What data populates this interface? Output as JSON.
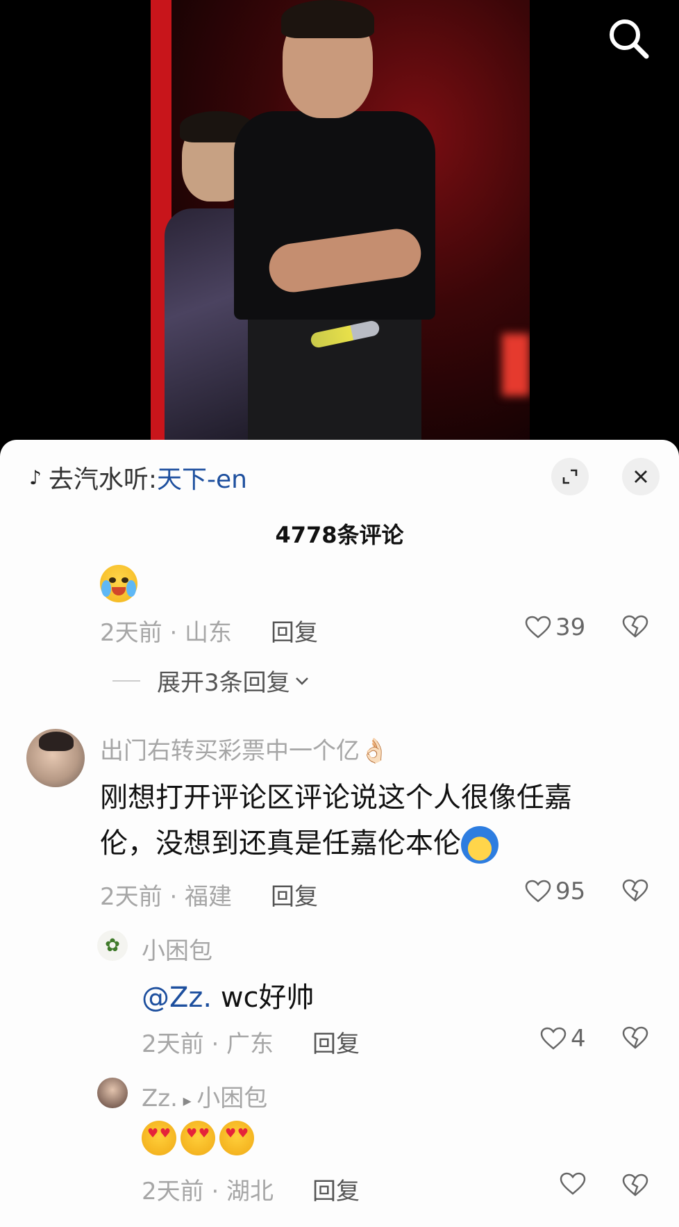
{
  "music": {
    "prefix": "去汽水听: ",
    "song": "天下-en"
  },
  "comments_count": "4778条评论",
  "comment0": {
    "meta": "2天前 · 山东",
    "reply": "回复",
    "likes": "39",
    "expand": "展开3条回复"
  },
  "comment1": {
    "user": "出门右转买彩票中一个亿👌🏻",
    "text_line1": "刚想打开评论区评论说这个人很像任嘉",
    "text_line2": "伦，没想到还真是任嘉伦本伦",
    "meta": "2天前 · 福建",
    "reply": "回复",
    "likes": "95"
  },
  "reply1": {
    "user": "小困包",
    "mention": "@Zz.",
    "text": " wc好帅",
    "meta": "2天前 · 广东",
    "reply": "回复",
    "likes": "4"
  },
  "reply2": {
    "user": "Zz.",
    "arrow": " ▸ ",
    "target": "小困包",
    "meta": "2天前 · 湖北",
    "reply": "回复",
    "likes": ""
  },
  "icons": {
    "search": "search-icon",
    "music": "music-note-icon",
    "expand": "expand-icon",
    "close": "close-icon",
    "like": "heart-outline-icon",
    "dislike": "broken-heart-icon"
  }
}
